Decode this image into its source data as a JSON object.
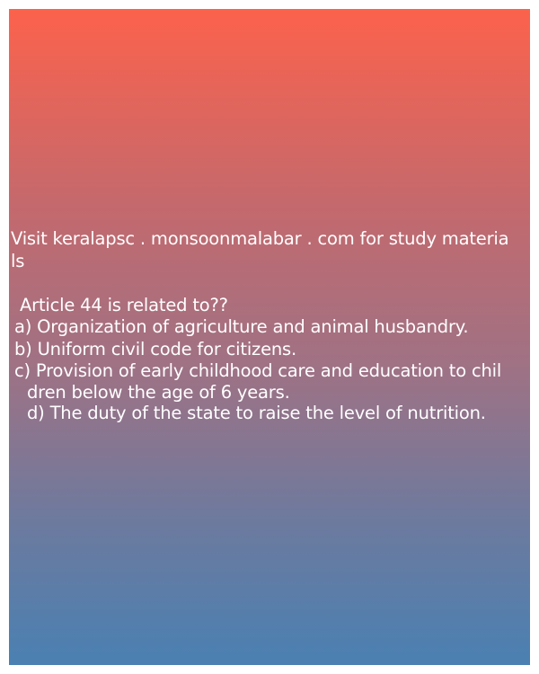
{
  "promo": {
    "line1": "Visit keralapsc . monsoonmalabar . com for study materia",
    "line2": "ls"
  },
  "question": {
    "text": "Article 44 is related to??",
    "options": [
      {
        "text": "a) Organization of agriculture and animal husbandry."
      },
      {
        "text": "b) Uniform civil code for citizens."
      },
      {
        "text": "c) Provision of early childhood care and education to chil",
        "continuation": "dren below the age of 6 years."
      },
      {
        "text": "d) The duty of the state to raise the level of nutrition."
      }
    ]
  },
  "colors": {
    "gradient_top": "#fc624c",
    "gradient_bottom": "#4a80b2",
    "text": "#ffffff"
  }
}
